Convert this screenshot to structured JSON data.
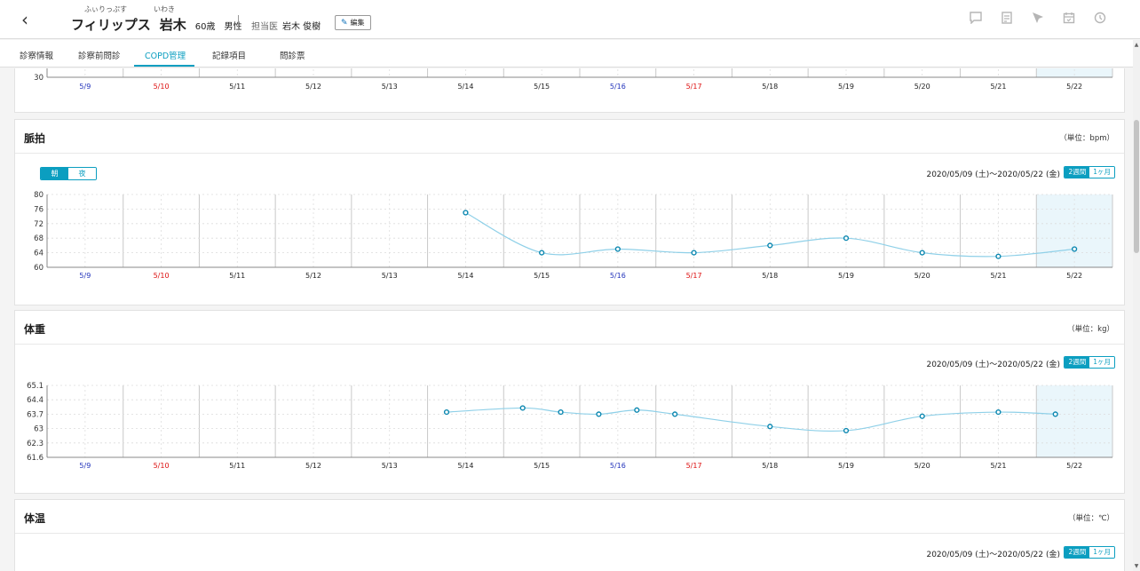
{
  "header": {
    "back_icon": "chevron-left-icon",
    "ruby_first": "ふぃりっぷす",
    "ruby_last": "いわき",
    "first_name": "フィリップス",
    "last_name": "岩木",
    "age": "60歳",
    "sex": "男性",
    "doctor_label": "担当医",
    "doctor_name": "岩木 俊樹",
    "edit_label": "編集",
    "icons": [
      "chat-icon",
      "memo-icon",
      "send-icon",
      "calendar-icon",
      "history-icon"
    ]
  },
  "tabs": [
    {
      "label": "診察情報"
    },
    {
      "label": "診察前問診"
    },
    {
      "label": "COPD管理"
    },
    {
      "label": "記録項目"
    },
    {
      "label": "問診票"
    }
  ],
  "dates": [
    "5/9",
    "5/10",
    "5/11",
    "5/12",
    "5/13",
    "5/14",
    "5/15",
    "5/16",
    "5/17",
    "5/18",
    "5/19",
    "5/20",
    "5/21",
    "5/22"
  ],
  "date_colors": [
    "#2233bb",
    "#dd1111",
    "#222222",
    "#222222",
    "#222222",
    "#222222",
    "#222222",
    "#2233bb",
    "#dd1111",
    "#222222",
    "#222222",
    "#222222",
    "#222222",
    "#222222"
  ],
  "colors": {
    "accent": "#0b9ec0",
    "line": "#8fd0e8",
    "point": "#0b87b0",
    "highlight": "#eaf6fb"
  },
  "top_panel": {
    "y_tick": "30"
  },
  "pulse": {
    "title": "脈拍",
    "unit": "（単位：bpm）",
    "morning": "朝",
    "night": "夜",
    "range": "2020/05/09 (土)〜2020/05/22 (金)",
    "period_2w": "2週間",
    "period_1m": "1ヶ月"
  },
  "weight": {
    "title": "体重",
    "unit": "（単位：kg）",
    "range": "2020/05/09 (土)〜2020/05/22 (金)",
    "period_2w": "2週間",
    "period_1m": "1ヶ月"
  },
  "temp": {
    "title": "体温",
    "unit": "（単位：℃）",
    "range": "2020/05/09 (土)〜2020/05/22 (金)",
    "period_2w": "2週間",
    "period_1m": "1ヶ月"
  },
  "chart_data": [
    {
      "type": "line",
      "categories": [
        "5/9",
        "5/10",
        "5/11",
        "5/12",
        "5/13",
        "5/14",
        "5/15",
        "5/16",
        "5/17",
        "5/18",
        "5/19",
        "5/20",
        "5/21",
        "5/22"
      ],
      "y_ticks": [
        "80",
        "76",
        "72",
        "68",
        "64",
        "60"
      ],
      "ylim": [
        60,
        80
      ],
      "points": [
        [
          5,
          75
        ],
        [
          6,
          64
        ],
        [
          7,
          65
        ],
        [
          8,
          64
        ],
        [
          9,
          66
        ],
        [
          10,
          68
        ],
        [
          11,
          64
        ],
        [
          12,
          63
        ],
        [
          13,
          65
        ]
      ],
      "grid": true
    },
    {
      "type": "line",
      "categories": [
        "5/9",
        "5/10",
        "5/11",
        "5/12",
        "5/13",
        "5/14",
        "5/15",
        "5/16",
        "5/17",
        "5/18",
        "5/19",
        "5/20",
        "5/21",
        "5/22"
      ],
      "y_ticks": [
        "65.1",
        "64.4",
        "63.7",
        "63",
        "62.3",
        "61.6"
      ],
      "ylim": [
        61.6,
        65.1
      ],
      "points": [
        [
          4.75,
          63.8
        ],
        [
          5.75,
          64.0
        ],
        [
          6.25,
          63.8
        ],
        [
          6.75,
          63.7
        ],
        [
          7.25,
          63.9
        ],
        [
          7.75,
          63.7
        ],
        [
          9.0,
          63.1
        ],
        [
          10.0,
          62.9
        ],
        [
          11.0,
          63.6
        ],
        [
          12.0,
          63.8
        ],
        [
          12.75,
          63.7
        ]
      ],
      "grid": true
    }
  ]
}
